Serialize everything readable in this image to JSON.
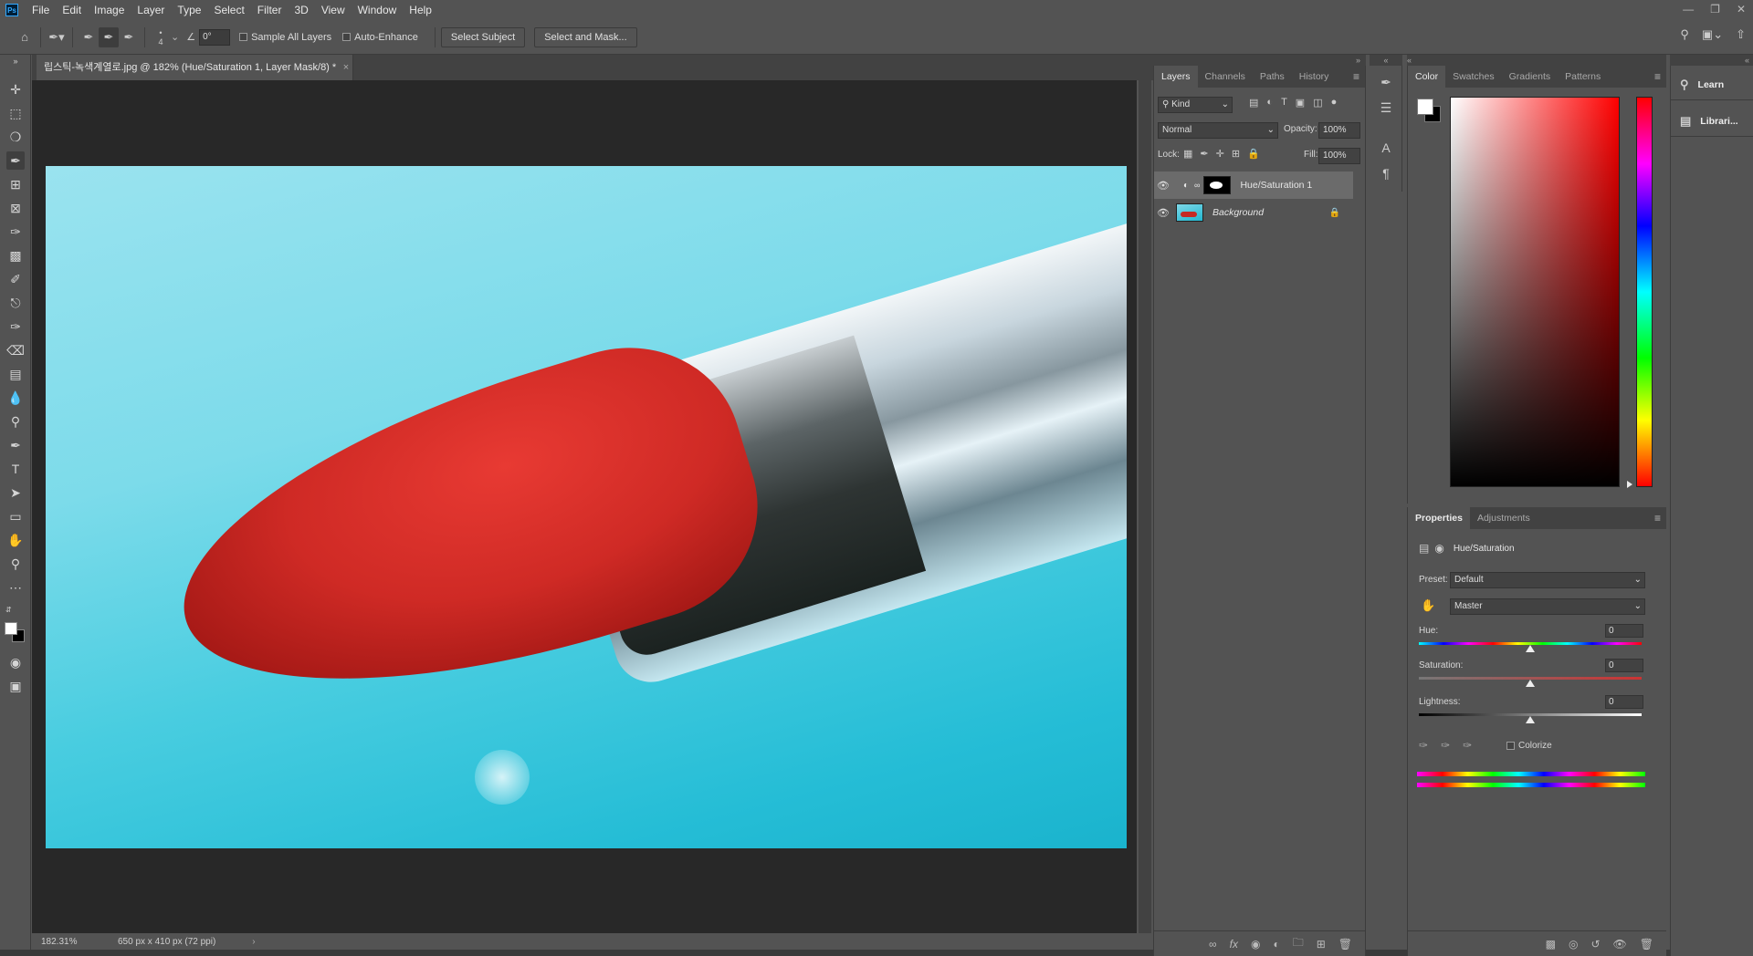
{
  "menubar": {
    "logo": "Ps",
    "items": [
      "File",
      "Edit",
      "Image",
      "Layer",
      "Type",
      "Select",
      "Filter",
      "3D",
      "View",
      "Window",
      "Help"
    ]
  },
  "options": {
    "brush_size": "4",
    "angle": "0°",
    "sample_all_layers": "Sample All Layers",
    "auto_enhance": "Auto-Enhance",
    "select_subject": "Select Subject",
    "select_and_mask": "Select and Mask..."
  },
  "document": {
    "tab_title": "립스틱-녹색계열로.jpg @ 182% (Hue/Saturation 1, Layer Mask/8) *",
    "zoom": "182.31%",
    "doc_info": "650 px x 410 px (72 ppi)"
  },
  "layers_panel": {
    "tabs": [
      "Layers",
      "Channels",
      "Paths",
      "History"
    ],
    "filter_kind": "Kind",
    "blend_mode": "Normal",
    "opacity_label": "Opacity:",
    "opacity_value": "100%",
    "lock_label": "Lock:",
    "fill_label": "Fill:",
    "fill_value": "100%",
    "layers": [
      {
        "name": "Hue/Saturation 1"
      },
      {
        "name": "Background"
      }
    ]
  },
  "color_panel": {
    "tabs": [
      "Color",
      "Swatches",
      "Gradients",
      "Patterns"
    ]
  },
  "properties_panel": {
    "tabs": [
      "Properties",
      "Adjustments"
    ],
    "title": "Hue/Saturation",
    "preset_label": "Preset:",
    "preset_value": "Default",
    "channel_value": "Master",
    "hue_label": "Hue:",
    "hue_value": "0",
    "saturation_label": "Saturation:",
    "saturation_value": "0",
    "lightness_label": "Lightness:",
    "lightness_value": "0",
    "colorize_label": "Colorize"
  },
  "learn_col": {
    "learn": "Learn",
    "libraries": "Librari..."
  },
  "colors": {
    "accent": "#31a8ff",
    "panel_bg": "#535353",
    "canvas_bg": "#282828"
  }
}
